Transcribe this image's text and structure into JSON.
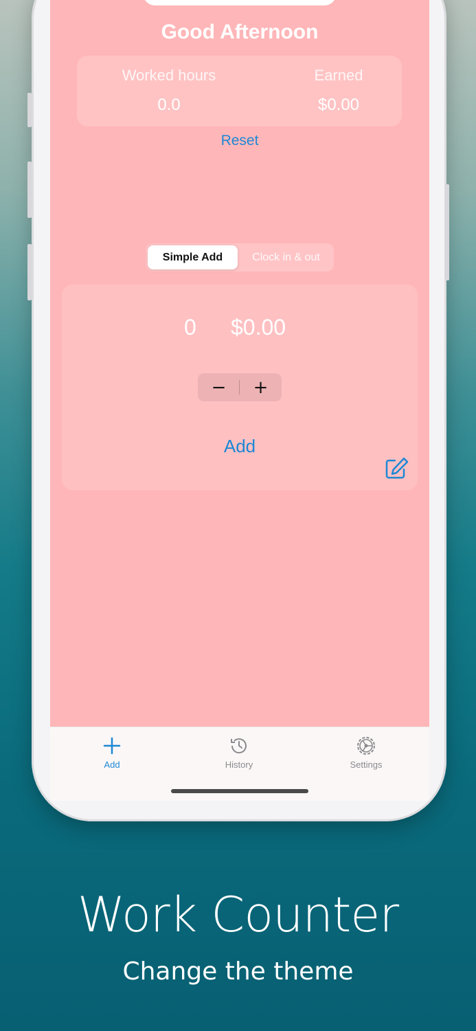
{
  "app": {
    "greeting": "Good Afternoon",
    "accent_color": "#1d88d4",
    "theme_color": "#ffb6b8"
  },
  "stats": {
    "worked_label": "Worked hours",
    "worked_value": "0.0",
    "earned_label": "Earned",
    "earned_value": "$0.00"
  },
  "reset_label": "Reset",
  "segment": {
    "options": [
      "Simple Add",
      "Clock in & out"
    ],
    "selected": "Simple Add"
  },
  "counter": {
    "hours": "0",
    "money": "$0.00",
    "minus_symbol": "−",
    "plus_symbol": "+"
  },
  "add_label": "Add",
  "edit_icon": "edit-icon",
  "tabbar": {
    "items": [
      {
        "label": "Add",
        "icon": "plus-icon",
        "active": true
      },
      {
        "label": "History",
        "icon": "history-icon",
        "active": false
      },
      {
        "label": "Settings",
        "icon": "gear-icon",
        "active": false
      }
    ]
  },
  "marketing": {
    "title": "Work Counter",
    "subtitle": "Change the theme"
  }
}
